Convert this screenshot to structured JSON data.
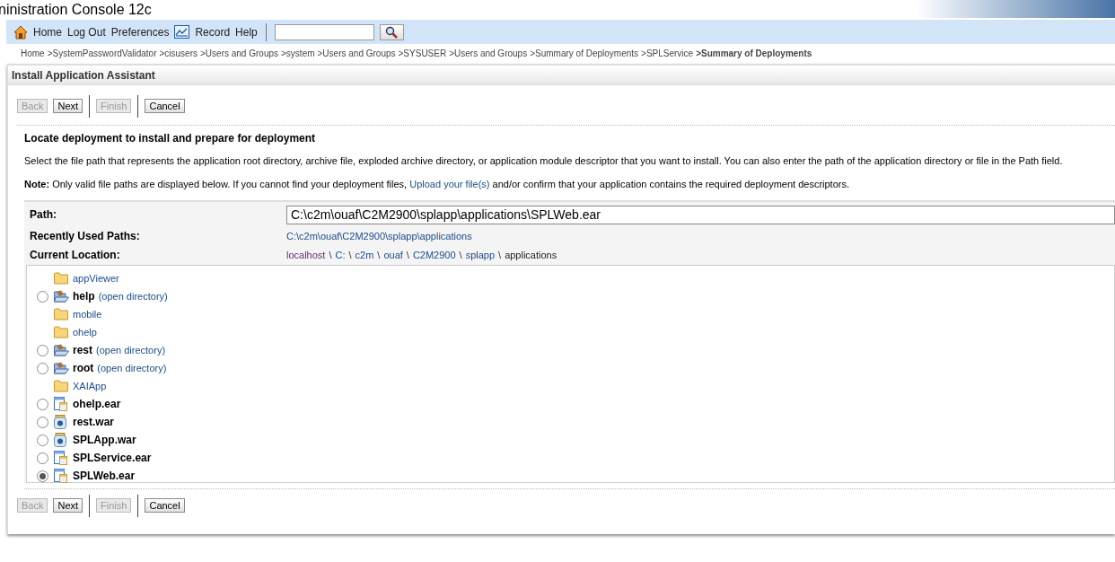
{
  "window": {
    "title": "ninistration Console 12c"
  },
  "toolbar": {
    "items": [
      {
        "kind": "home",
        "label": "Home"
      },
      {
        "kind": "plain",
        "label": "Log Out"
      },
      {
        "kind": "plain",
        "label": "Preferences"
      },
      {
        "kind": "record",
        "label": "Record"
      },
      {
        "kind": "plain",
        "label": "Help"
      }
    ]
  },
  "breadcrumb": [
    {
      "label": "Home",
      "current": false
    },
    {
      "label": ">SystemPasswordValidator",
      "current": false
    },
    {
      "label": ">cisusers",
      "current": false
    },
    {
      "label": ">Users and Groups",
      "current": false
    },
    {
      "label": ">system",
      "current": false
    },
    {
      "label": ">Users and Groups",
      "current": false
    },
    {
      "label": ">SYSUSER",
      "current": false
    },
    {
      "label": ">Users and Groups",
      "current": false
    },
    {
      "label": ">Summary of Deployments",
      "current": false
    },
    {
      "label": ">SPLService",
      "current": false
    },
    {
      "label": ">Summary of Deployments",
      "current": true
    }
  ],
  "panel": {
    "title": "Install Application Assistant"
  },
  "button_bars": [
    [
      {
        "label": "Back",
        "disabled": true
      },
      {
        "label": "Next",
        "disabled": false
      },
      {
        "label": "Finish",
        "disabled": true
      },
      {
        "label": "Cancel",
        "disabled": false
      }
    ],
    [
      {
        "label": "Back",
        "disabled": true
      },
      {
        "label": "Next",
        "disabled": false
      },
      {
        "label": "Finish",
        "disabled": true
      },
      {
        "label": "Cancel",
        "disabled": false
      }
    ]
  ],
  "heading": "Locate deployment to install and prepare for deployment",
  "description": "Select the file path that represents the application root directory, archive file, exploded archive directory, or application module descriptor that you want to install. You can also enter the path of the application directory or file in the Path field.",
  "note": {
    "label": "Note:",
    "before": "Only valid file paths are displayed below. If you cannot find your deployment files,",
    "link": "Upload your file(s)",
    "after": "and/or confirm that your application contains the required deployment descriptors."
  },
  "path": {
    "label": "Path:",
    "value": "C:\\c2m\\ouaf\\C2M2900\\splapp\\applications\\SPLWeb.ear"
  },
  "recent": {
    "label": "Recently Used Paths:",
    "link": "C:\\c2m\\ouaf\\C2M2900\\splapp\\applications"
  },
  "location": {
    "label": "Current Location:",
    "segments": [
      {
        "label": "localhost",
        "visited": true,
        "link": true
      },
      {
        "label": "C:",
        "visited": false,
        "link": true
      },
      {
        "label": "c2m",
        "visited": false,
        "link": true
      },
      {
        "label": "ouaf",
        "visited": false,
        "link": true
      },
      {
        "label": "C2M2900",
        "visited": false,
        "link": true
      },
      {
        "label": "splapp",
        "visited": false,
        "link": true
      },
      {
        "label": "applications",
        "link": false
      }
    ],
    "separator": "\\"
  },
  "entries": [
    {
      "kind": "folder",
      "name": "appViewer"
    },
    {
      "kind": "open_dir",
      "name": "help",
      "action": "(open directory)",
      "selected": false
    },
    {
      "kind": "folder",
      "name": "mobile"
    },
    {
      "kind": "folder",
      "name": "ohelp"
    },
    {
      "kind": "open_dir",
      "name": "rest",
      "action": "(open directory)",
      "selected": false
    },
    {
      "kind": "open_dir",
      "name": "root",
      "action": "(open directory)",
      "selected": false
    },
    {
      "kind": "folder",
      "name": "XAIApp"
    },
    {
      "kind": "ear",
      "name": "ohelp.ear",
      "selected": false
    },
    {
      "kind": "war",
      "name": "rest.war",
      "selected": false
    },
    {
      "kind": "war",
      "name": "SPLApp.war",
      "selected": false
    },
    {
      "kind": "ear",
      "name": "SPLService.ear",
      "selected": false
    },
    {
      "kind": "ear",
      "name": "SPLWeb.ear",
      "selected": true
    }
  ]
}
